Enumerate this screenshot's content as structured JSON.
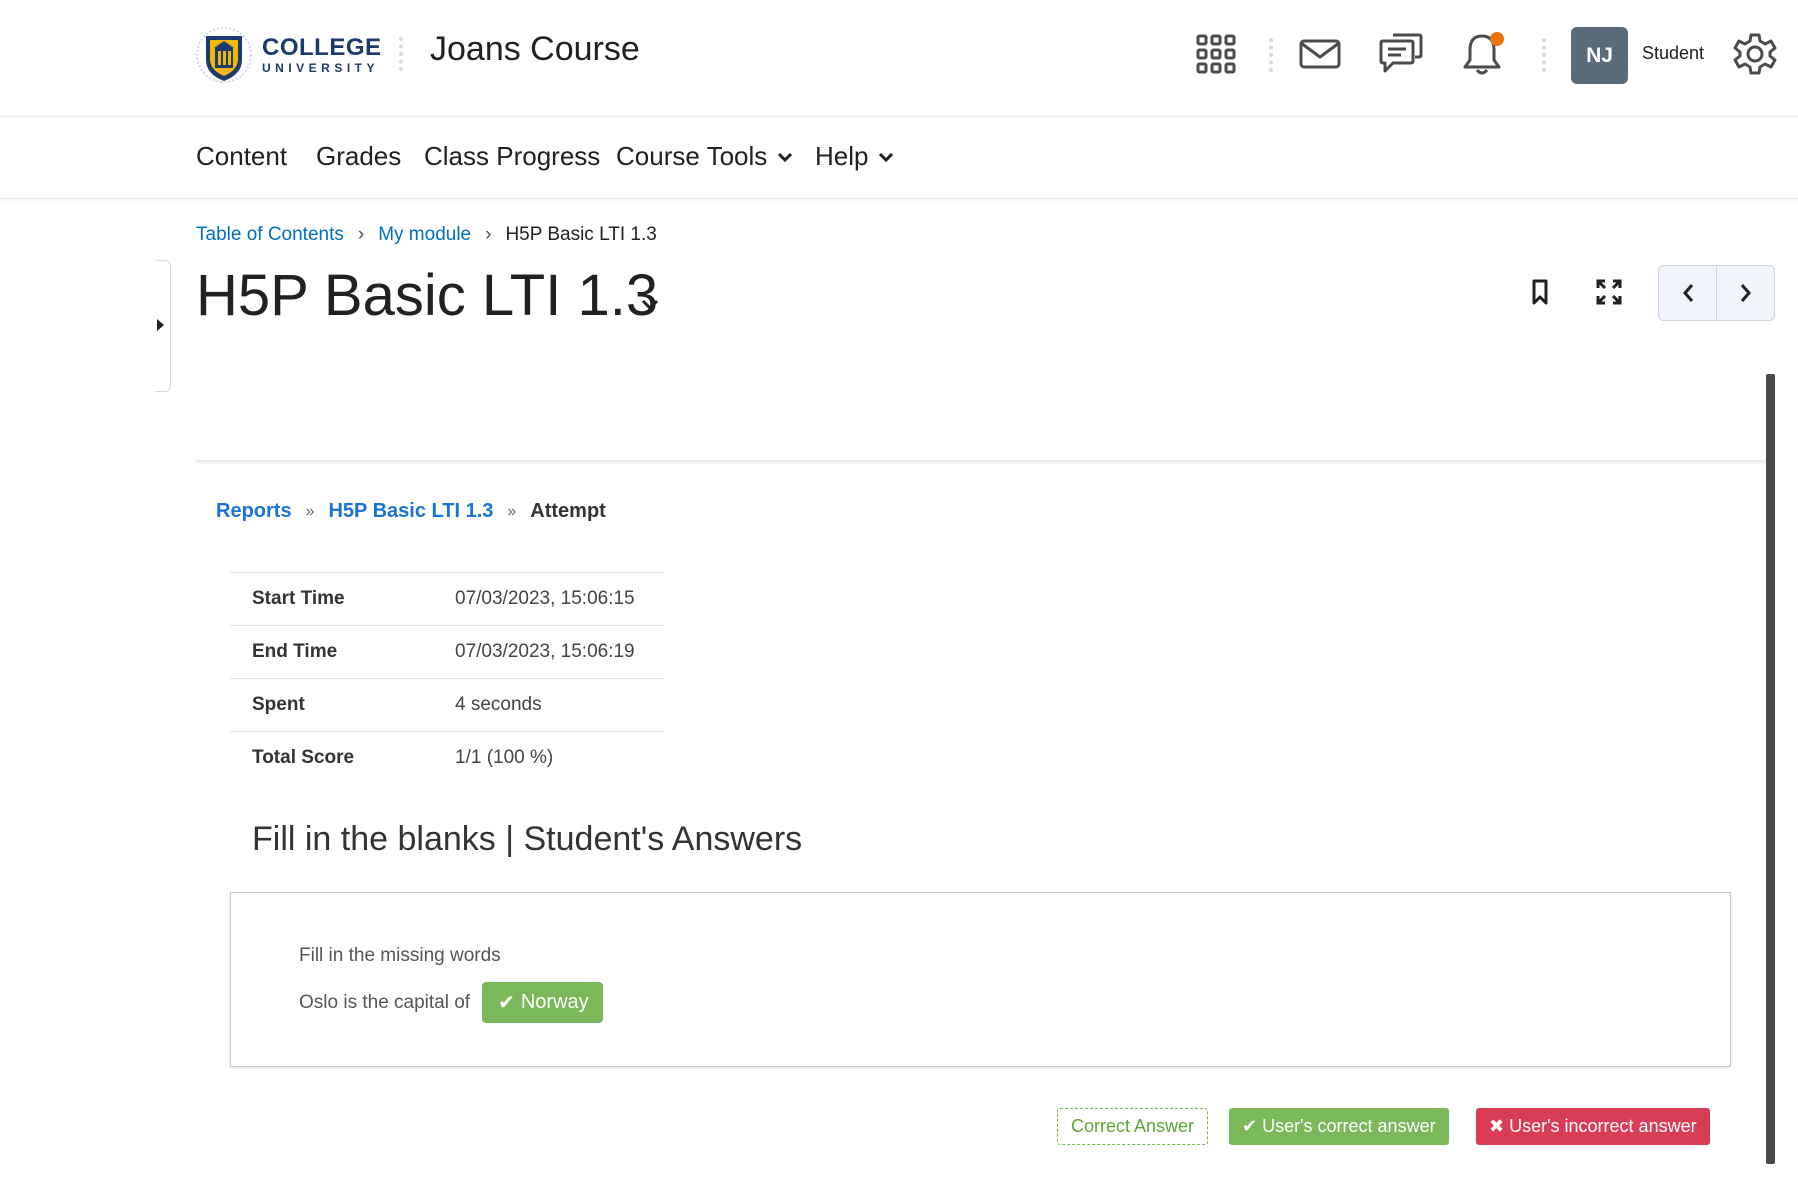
{
  "header": {
    "logo": {
      "line1": "COLLEGE",
      "line2": "UNIVERSITY"
    },
    "course_title": "Joans Course",
    "icons": [
      "apps-grid-icon",
      "mail-icon",
      "chat-icon",
      "bell-icon",
      "settings-gear-icon"
    ],
    "notification_dot_color": "#e87511",
    "avatar_initials": "NJ",
    "username": "Student"
  },
  "nav": {
    "items": [
      {
        "label": "Content",
        "has_dropdown": false
      },
      {
        "label": "Grades",
        "has_dropdown": false
      },
      {
        "label": "Class Progress",
        "has_dropdown": false
      },
      {
        "label": "Course Tools",
        "has_dropdown": true
      },
      {
        "label": "Help",
        "has_dropdown": true
      }
    ]
  },
  "breadcrumb": {
    "items": [
      "Table of Contents",
      "My module"
    ],
    "current": "H5P Basic LTI 1.3"
  },
  "page": {
    "title": "H5P Basic LTI 1.3",
    "tools": [
      "bookmark-icon",
      "fullscreen-icon",
      "previous-icon",
      "next-icon"
    ]
  },
  "report": {
    "crumbs": {
      "reports": "Reports",
      "item": "H5P Basic LTI 1.3",
      "current": "Attempt",
      "sep": "»"
    },
    "stats": [
      {
        "key": "Start Time",
        "value": "07/03/2023, 15:06:15"
      },
      {
        "key": "End Time",
        "value": "07/03/2023, 15:06:19"
      },
      {
        "key": "Spent",
        "value": "4 seconds"
      },
      {
        "key": "Total Score",
        "value": "1/1 (100 %)"
      }
    ],
    "section_heading": "Fill in the blanks | Student's Answers",
    "task": "Fill in the missing words",
    "sentence_prefix": "Oslo is the capital of",
    "answer": "Norway",
    "legend": {
      "correct": "Correct Answer",
      "user_correct": "User's correct answer",
      "user_incorrect": "User's incorrect answer"
    },
    "colors": {
      "correct": "#7ab85a",
      "incorrect": "#d93d55",
      "link": "#1a73d9"
    }
  }
}
